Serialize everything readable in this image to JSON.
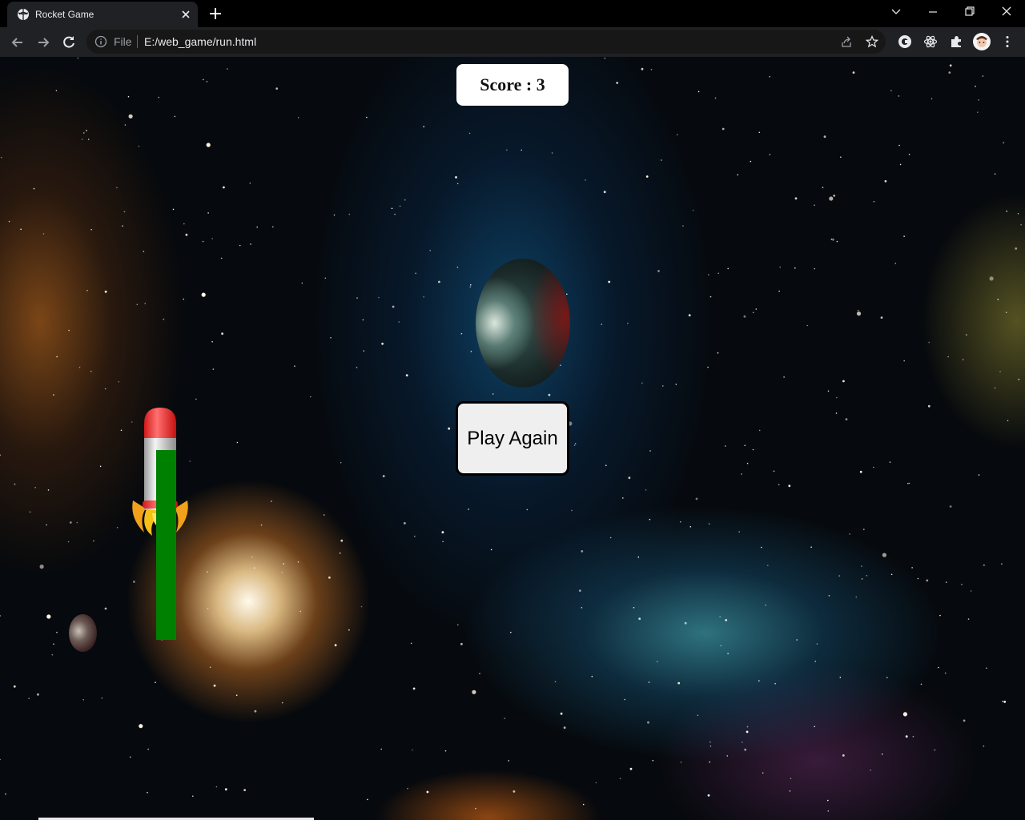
{
  "browser": {
    "tab_title": "Rocket Game",
    "omnibox_scheme": "File",
    "omnibox_url": "E:/web_game/run.html"
  },
  "game": {
    "score_text": "Score : 3",
    "play_again_label": "Play Again",
    "fuel_level": 0.94
  },
  "colors": {
    "fuel_bar": "#008000",
    "rocket_cap": "#ff3333",
    "rocket_body": "#d8d8d8",
    "flame": "#f2a21a"
  },
  "icons": [
    "tab-favicon-icon",
    "close-icon",
    "plus-icon",
    "chevron-down-icon",
    "minimize-icon",
    "restore-icon",
    "window-close-icon",
    "back-arrow-icon",
    "forward-arrow-icon",
    "reload-icon",
    "info-icon",
    "share-icon",
    "star-icon",
    "extension-icon",
    "puzzle-icon",
    "avatar",
    "kebab-menu-icon"
  ]
}
